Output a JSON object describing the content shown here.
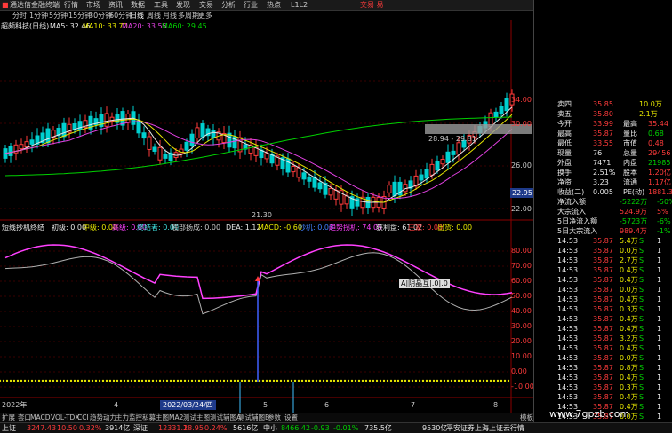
{
  "window": {
    "app_name": "通达信金融终端",
    "menu": [
      "行情",
      "市场",
      "资讯",
      "数据",
      "工具",
      "发现",
      "交易",
      "分析",
      "行业",
      "热点",
      "L1L2"
    ],
    "right_label": "交易 易"
  },
  "period_bar": {
    "items": [
      "分时",
      "1分钟",
      "5分钟",
      "15分钟",
      "30分钟",
      "60分钟",
      "日线",
      "周线",
      "月线",
      "多周期",
      "更多"
    ],
    "active": "日线"
  },
  "chart": {
    "stock_title": "超频科技(日线)",
    "ma_labels": [
      {
        "text": "MA5: 32.46",
        "color": "#e8e8e8"
      },
      {
        "text": "MA10: 33.70",
        "color": "#e8e800"
      },
      {
        "text": "MA20: 33.55",
        "color": "#e040e0"
      },
      {
        "text": "MA60: 29.45",
        "color": "#00d000"
      }
    ],
    "price_axis": [
      "34.00",
      "32.00",
      "30.00",
      "28.00",
      "26.00",
      "24.00",
      "22.00"
    ],
    "current_price_tag": "22.95",
    "low_marker": "21.30",
    "range_marker": "28.94 - 29.81",
    "indicator_title": "短线抄机终结",
    "indicator_values": [
      {
        "text": "初级: 0.00",
        "color": "#e8e8e8"
      },
      {
        "text": "中级: 0.00",
        "color": "#e8e800"
      },
      {
        "text": "高级: 0.00",
        "color": "#ff40ff"
      },
      {
        "text": "终结者: 0.00",
        "color": "#40e0e0"
      },
      {
        "text": "底部扬成: 0.00",
        "color": "#c8c8c8"
      },
      {
        "text": "DEA: 1.12",
        "color": "#e8e8e8"
      },
      {
        "text": "MACD: -0.60",
        "color": "#e8e800"
      },
      {
        "text": "抄机: 0.00",
        "color": "#4080ff"
      },
      {
        "text": "趋势拐机: 74.05",
        "color": "#ff40ff"
      },
      {
        "text": "获利盘: 61.02",
        "color": "#e8e8e8"
      },
      {
        "text": "庄家: 0.00",
        "color": "#ff3b3b"
      },
      {
        "text": "出货: 0.00",
        "color": "#e8e800"
      }
    ],
    "indicator_axis": [
      "80.00",
      "70.00",
      "60.00",
      "50.00",
      "40.00",
      "30.00",
      "20.00",
      "10.00",
      "0.00",
      "-10.00"
    ],
    "indicator_tooltip": "A|阴晶互|.0|.0",
    "date_axis": [
      "2022年",
      "4",
      "5",
      "6",
      "7",
      "8"
    ],
    "cursor_date": "2022/03/24/四"
  },
  "bottom_tabs": [
    "扩展",
    "套口",
    "MACD",
    "VOL-TDX",
    "CCI",
    "趋势动力",
    "主力监控",
    "私募主图",
    "MA2",
    "测试主图",
    "测试辅图A",
    "测试辅图B",
    "参数",
    "设置",
    "模板"
  ],
  "bottom_tabs2": [
    "扩展",
    "关联报价",
    "资金分布",
    "综合资讯",
    "行业资讯",
    "互动问答",
    "省局户模利专章"
  ],
  "quote_panel": {
    "rows": [
      {
        "label": "卖四",
        "price": "35.85",
        "vol": "10.0万"
      },
      {
        "label": "卖五",
        "price": "35.80",
        "vol": "2.1万"
      },
      {
        "label": "今开",
        "price": "33.99",
        "label2": "最高",
        "val2": "35.44"
      },
      {
        "label": "最高",
        "price": "35.87",
        "label2": "量比",
        "val2": "0.68"
      },
      {
        "label": "最低",
        "price": "33.55",
        "label2": "市值",
        "val2": "0.48"
      },
      {
        "label": "现量",
        "price": "76",
        "label2": "总量",
        "val2": "29456"
      },
      {
        "label": "外盘",
        "price": "7471",
        "label2": "内盘",
        "val2": "21985"
      },
      {
        "label": "换手",
        "price": "2.51%",
        "label2": "股本",
        "val2": "1.20亿"
      },
      {
        "label": "净资",
        "price": "3.23",
        "label2": "流通",
        "val2": "1.17亿"
      },
      {
        "label": "收益(二)",
        "price": "0.005",
        "label2": "PE(动)",
        "val2": "1881.3"
      }
    ],
    "flows": [
      {
        "label": "净流入额",
        "value": "-5222万",
        "pct": "-50%"
      },
      {
        "label": "大宗流入",
        "value": "524.9万",
        "pct": "5%"
      },
      {
        "label": "5日净流入额",
        "value": "-5723万",
        "pct": "-6%"
      },
      {
        "label": "5日大宗流入",
        "value": "989.4万",
        "pct": "-1%"
      }
    ],
    "ticks": [
      {
        "time": "14:53",
        "price": "35.87",
        "vol": "5.4万",
        "bs": "S",
        "n": "1"
      },
      {
        "time": "14:53",
        "price": "35.87",
        "vol": "0.0万",
        "bs": "S",
        "n": "1"
      },
      {
        "time": "14:53",
        "price": "35.87",
        "vol": "2.7万",
        "bs": "S",
        "n": "1"
      },
      {
        "time": "14:53",
        "price": "35.87",
        "vol": "0.4万",
        "bs": "S",
        "n": "1"
      },
      {
        "time": "14:53",
        "price": "35.87",
        "vol": "0.4万",
        "bs": "S",
        "n": "1"
      },
      {
        "time": "14:53",
        "price": "35.87",
        "vol": "0.0万",
        "bs": "S",
        "n": "1"
      },
      {
        "time": "14:53",
        "price": "35.87",
        "vol": "0.4万",
        "bs": "S",
        "n": "1"
      },
      {
        "time": "14:53",
        "price": "35.87",
        "vol": "0.3万",
        "bs": "S",
        "n": "1"
      },
      {
        "time": "14:53",
        "price": "35.87",
        "vol": "0.4万",
        "bs": "S",
        "n": "1"
      },
      {
        "time": "14:53",
        "price": "35.87",
        "vol": "0.4万",
        "bs": "S",
        "n": "1"
      },
      {
        "time": "14:53",
        "price": "35.87",
        "vol": "3.2万",
        "bs": "S",
        "n": "1"
      },
      {
        "time": "14:53",
        "price": "35.87",
        "vol": "0.4万",
        "bs": "S",
        "n": "1"
      },
      {
        "time": "14:53",
        "price": "35.87",
        "vol": "0.0万",
        "bs": "S",
        "n": "1"
      },
      {
        "time": "14:53",
        "price": "35.87",
        "vol": "0.8万",
        "bs": "S",
        "n": "1"
      },
      {
        "time": "14:53",
        "price": "35.87",
        "vol": "0.4万",
        "bs": "S",
        "n": "1"
      },
      {
        "time": "14:53",
        "price": "35.87",
        "vol": "0.3万",
        "bs": "S",
        "n": "1"
      },
      {
        "time": "14:53",
        "price": "35.87",
        "vol": "0.4万",
        "bs": "S",
        "n": "1"
      },
      {
        "time": "14:53",
        "price": "35.87",
        "vol": "0.4万",
        "bs": "S",
        "n": "1"
      },
      {
        "time": "14:53",
        "price": "35.87",
        "vol": "0.0万",
        "bs": "S",
        "n": "1"
      },
      {
        "time": "14:53",
        "price": "35.87",
        "vol": "0.8万",
        "bs": "S",
        "n": "1"
      }
    ]
  },
  "status_bar": {
    "items": [
      {
        "label": "上证",
        "value": "3247.43",
        "change": "10.50",
        "pct": "0.32%",
        "amount": "3914亿"
      },
      {
        "label": "深证",
        "value": "12331.1",
        "change": "28.95",
        "pct": "0.24%",
        "amount": "5616亿"
      },
      {
        "label": "中小",
        "value": "8466.42",
        "change": "-0.93",
        "pct": "-0.01%",
        "amount": "735.5亿"
      }
    ],
    "extra": "9530亿",
    "ticker": "平安证券上海上证云行情",
    "watermark": "www.7gpzb.com"
  },
  "colors": {
    "up": "#ff3b3b",
    "down": "#00d000",
    "ma5": "#e8e8e8",
    "ma10": "#e8e800",
    "ma20": "#e040e0",
    "ma60": "#00d000"
  }
}
